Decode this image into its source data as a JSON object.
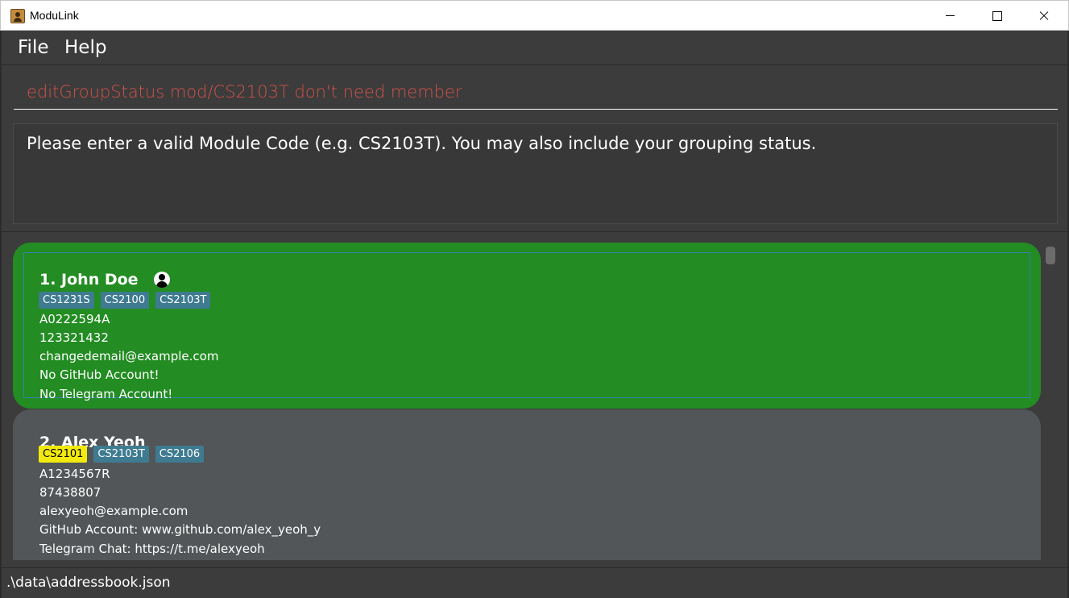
{
  "window": {
    "title": "ModuLink"
  },
  "menu": {
    "items": [
      "File",
      "Help"
    ]
  },
  "command": {
    "value": "editGroupStatus mod/CS2103T don't need member",
    "color": "#d1514a"
  },
  "result": {
    "message": "Please enter a valid Module Code (e.g. CS2103T). You may also include your grouping status."
  },
  "persons": [
    {
      "name": "1. John Doe",
      "selected": true,
      "is_self": true,
      "tags": [
        {
          "label": "CS1231S",
          "color": "#3e7b91"
        },
        {
          "label": "CS2100",
          "color": "#3e7b91"
        },
        {
          "label": "CS2103T",
          "color": "#3e7b91"
        }
      ],
      "id": "A0222594A",
      "phone": "123321432",
      "email": "changedemail@example.com",
      "github": "No GitHub Account!",
      "telegram": "No Telegram Account!"
    },
    {
      "name": "2. Alex Yeoh",
      "selected": false,
      "is_self": false,
      "tags": [
        {
          "label": "CS2101",
          "color": "#f2ea0e"
        },
        {
          "label": "CS2103T",
          "color": "#3e7b91"
        },
        {
          "label": "CS2106",
          "color": "#3e7b91"
        }
      ],
      "id": "A1234567R",
      "phone": "87438807",
      "email": "alexyeoh@example.com",
      "github": "GitHub Account: www.github.com/alex_yeoh_y",
      "telegram": "Telegram Chat: https://t.me/alexyeoh"
    }
  ],
  "status": {
    "file_path": ".\\data\\addressbook.json"
  },
  "colors": {
    "selected_card": "#238c23",
    "card": "#525658",
    "background": "#3c3c3c"
  }
}
